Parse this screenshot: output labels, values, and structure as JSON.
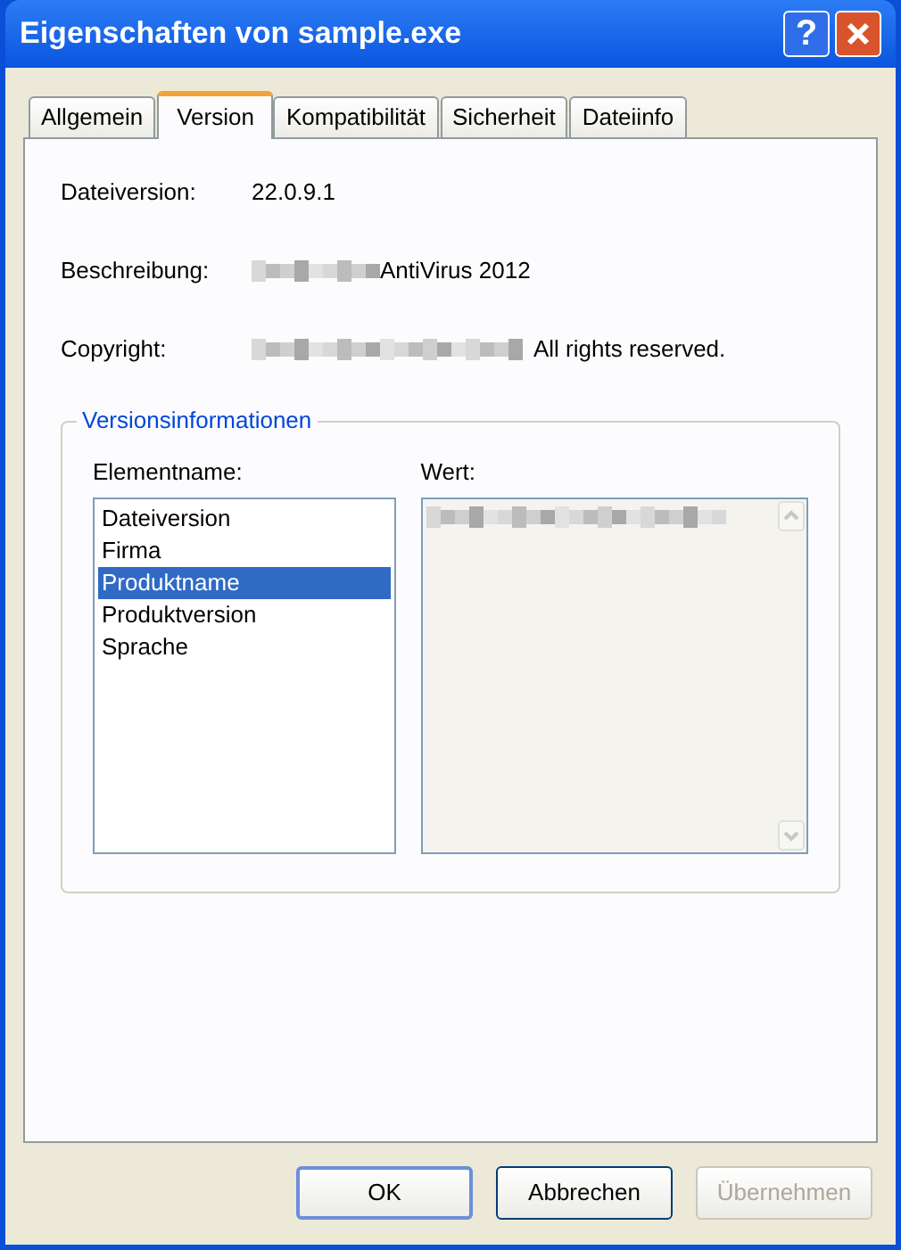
{
  "window": {
    "title": "Eigenschaften von sample.exe",
    "help_button": "?"
  },
  "tabs": [
    {
      "label": "Allgemein",
      "selected": false
    },
    {
      "label": "Version",
      "selected": true
    },
    {
      "label": "Kompatibilität",
      "selected": false
    },
    {
      "label": "Sicherheit",
      "selected": false
    },
    {
      "label": "Dateiinfo",
      "selected": false
    }
  ],
  "fields": [
    {
      "label": "Dateiversion:",
      "value": "22.0.9.1",
      "kind": "plain"
    },
    {
      "label": "Beschreibung:",
      "value": "AntiVirus 2012",
      "kind": "redacted_prefix"
    },
    {
      "label": "Copyright:",
      "value": "All rights reserved.",
      "kind": "redacted_prefix"
    }
  ],
  "group": {
    "title": "Versionsinformationen",
    "names_label": "Elementname:",
    "value_label": "Wert:",
    "items": [
      {
        "label": "Dateiversion",
        "selected": false
      },
      {
        "label": "Firma",
        "selected": false
      },
      {
        "label": "Produktname",
        "selected": true
      },
      {
        "label": "Produktversion",
        "selected": false
      },
      {
        "label": "Sprache",
        "selected": false
      }
    ],
    "value": {
      "kind": "redacted"
    }
  },
  "buttons": [
    {
      "label": "OK",
      "default": true,
      "disabled": false
    },
    {
      "label": "Abbrechen",
      "default": false,
      "disabled": false
    },
    {
      "label": "Übernehmen",
      "default": false,
      "disabled": true
    }
  ]
}
